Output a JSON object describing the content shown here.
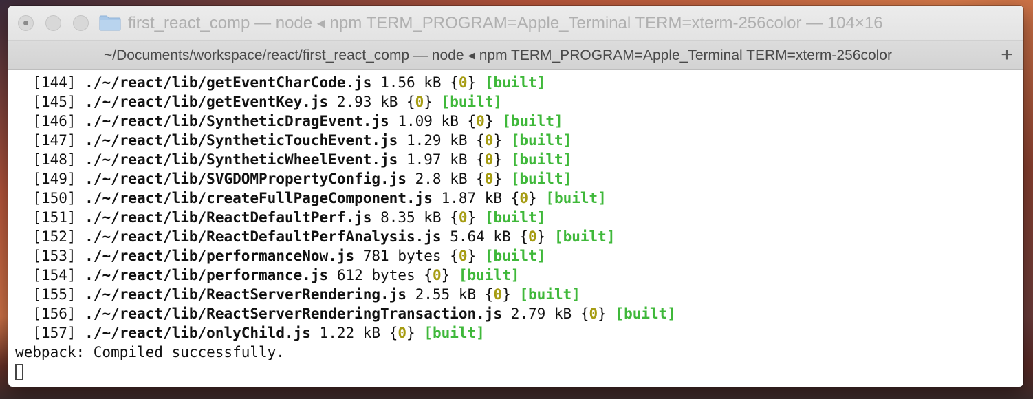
{
  "window": {
    "title": "first_react_comp — node ◂ npm TERM_PROGRAM=Apple_Terminal TERM=xterm-256color — 104×16",
    "tab_title": "~/Documents/workspace/react/first_react_comp — node ◂ npm TERM_PROGRAM=Apple_Terminal TERM=xterm-256color",
    "new_tab_label": "+"
  },
  "terminal": {
    "modules": [
      {
        "id": "[144]",
        "path": "./~/react/lib/getEventCharCode.js",
        "size": "1.56 kB",
        "chunk": "0",
        "status": "[built]"
      },
      {
        "id": "[145]",
        "path": "./~/react/lib/getEventKey.js",
        "size": "2.93 kB",
        "chunk": "0",
        "status": "[built]"
      },
      {
        "id": "[146]",
        "path": "./~/react/lib/SyntheticDragEvent.js",
        "size": "1.09 kB",
        "chunk": "0",
        "status": "[built]"
      },
      {
        "id": "[147]",
        "path": "./~/react/lib/SyntheticTouchEvent.js",
        "size": "1.29 kB",
        "chunk": "0",
        "status": "[built]"
      },
      {
        "id": "[148]",
        "path": "./~/react/lib/SyntheticWheelEvent.js",
        "size": "1.97 kB",
        "chunk": "0",
        "status": "[built]"
      },
      {
        "id": "[149]",
        "path": "./~/react/lib/SVGDOMPropertyConfig.js",
        "size": "2.8 kB",
        "chunk": "0",
        "status": "[built]"
      },
      {
        "id": "[150]",
        "path": "./~/react/lib/createFullPageComponent.js",
        "size": "1.87 kB",
        "chunk": "0",
        "status": "[built]"
      },
      {
        "id": "[151]",
        "path": "./~/react/lib/ReactDefaultPerf.js",
        "size": "8.35 kB",
        "chunk": "0",
        "status": "[built]"
      },
      {
        "id": "[152]",
        "path": "./~/react/lib/ReactDefaultPerfAnalysis.js",
        "size": "5.64 kB",
        "chunk": "0",
        "status": "[built]"
      },
      {
        "id": "[153]",
        "path": "./~/react/lib/performanceNow.js",
        "size": "781 bytes",
        "chunk": "0",
        "status": "[built]"
      },
      {
        "id": "[154]",
        "path": "./~/react/lib/performance.js",
        "size": "612 bytes",
        "chunk": "0",
        "status": "[built]"
      },
      {
        "id": "[155]",
        "path": "./~/react/lib/ReactServerRendering.js",
        "size": "2.55 kB",
        "chunk": "0",
        "status": "[built]"
      },
      {
        "id": "[156]",
        "path": "./~/react/lib/ReactServerRenderingTransaction.js",
        "size": "2.79 kB",
        "chunk": "0",
        "status": "[built]"
      },
      {
        "id": "[157]",
        "path": "./~/react/lib/onlyChild.js",
        "size": "1.22 kB",
        "chunk": "0",
        "status": "[built]"
      }
    ],
    "final_message": "webpack: Compiled successfully."
  },
  "colors": {
    "chunk_id": "#a69c12",
    "built_status": "#3fb83a"
  },
  "icons": {
    "folder": "folder-icon",
    "new_tab": "plus-icon"
  }
}
